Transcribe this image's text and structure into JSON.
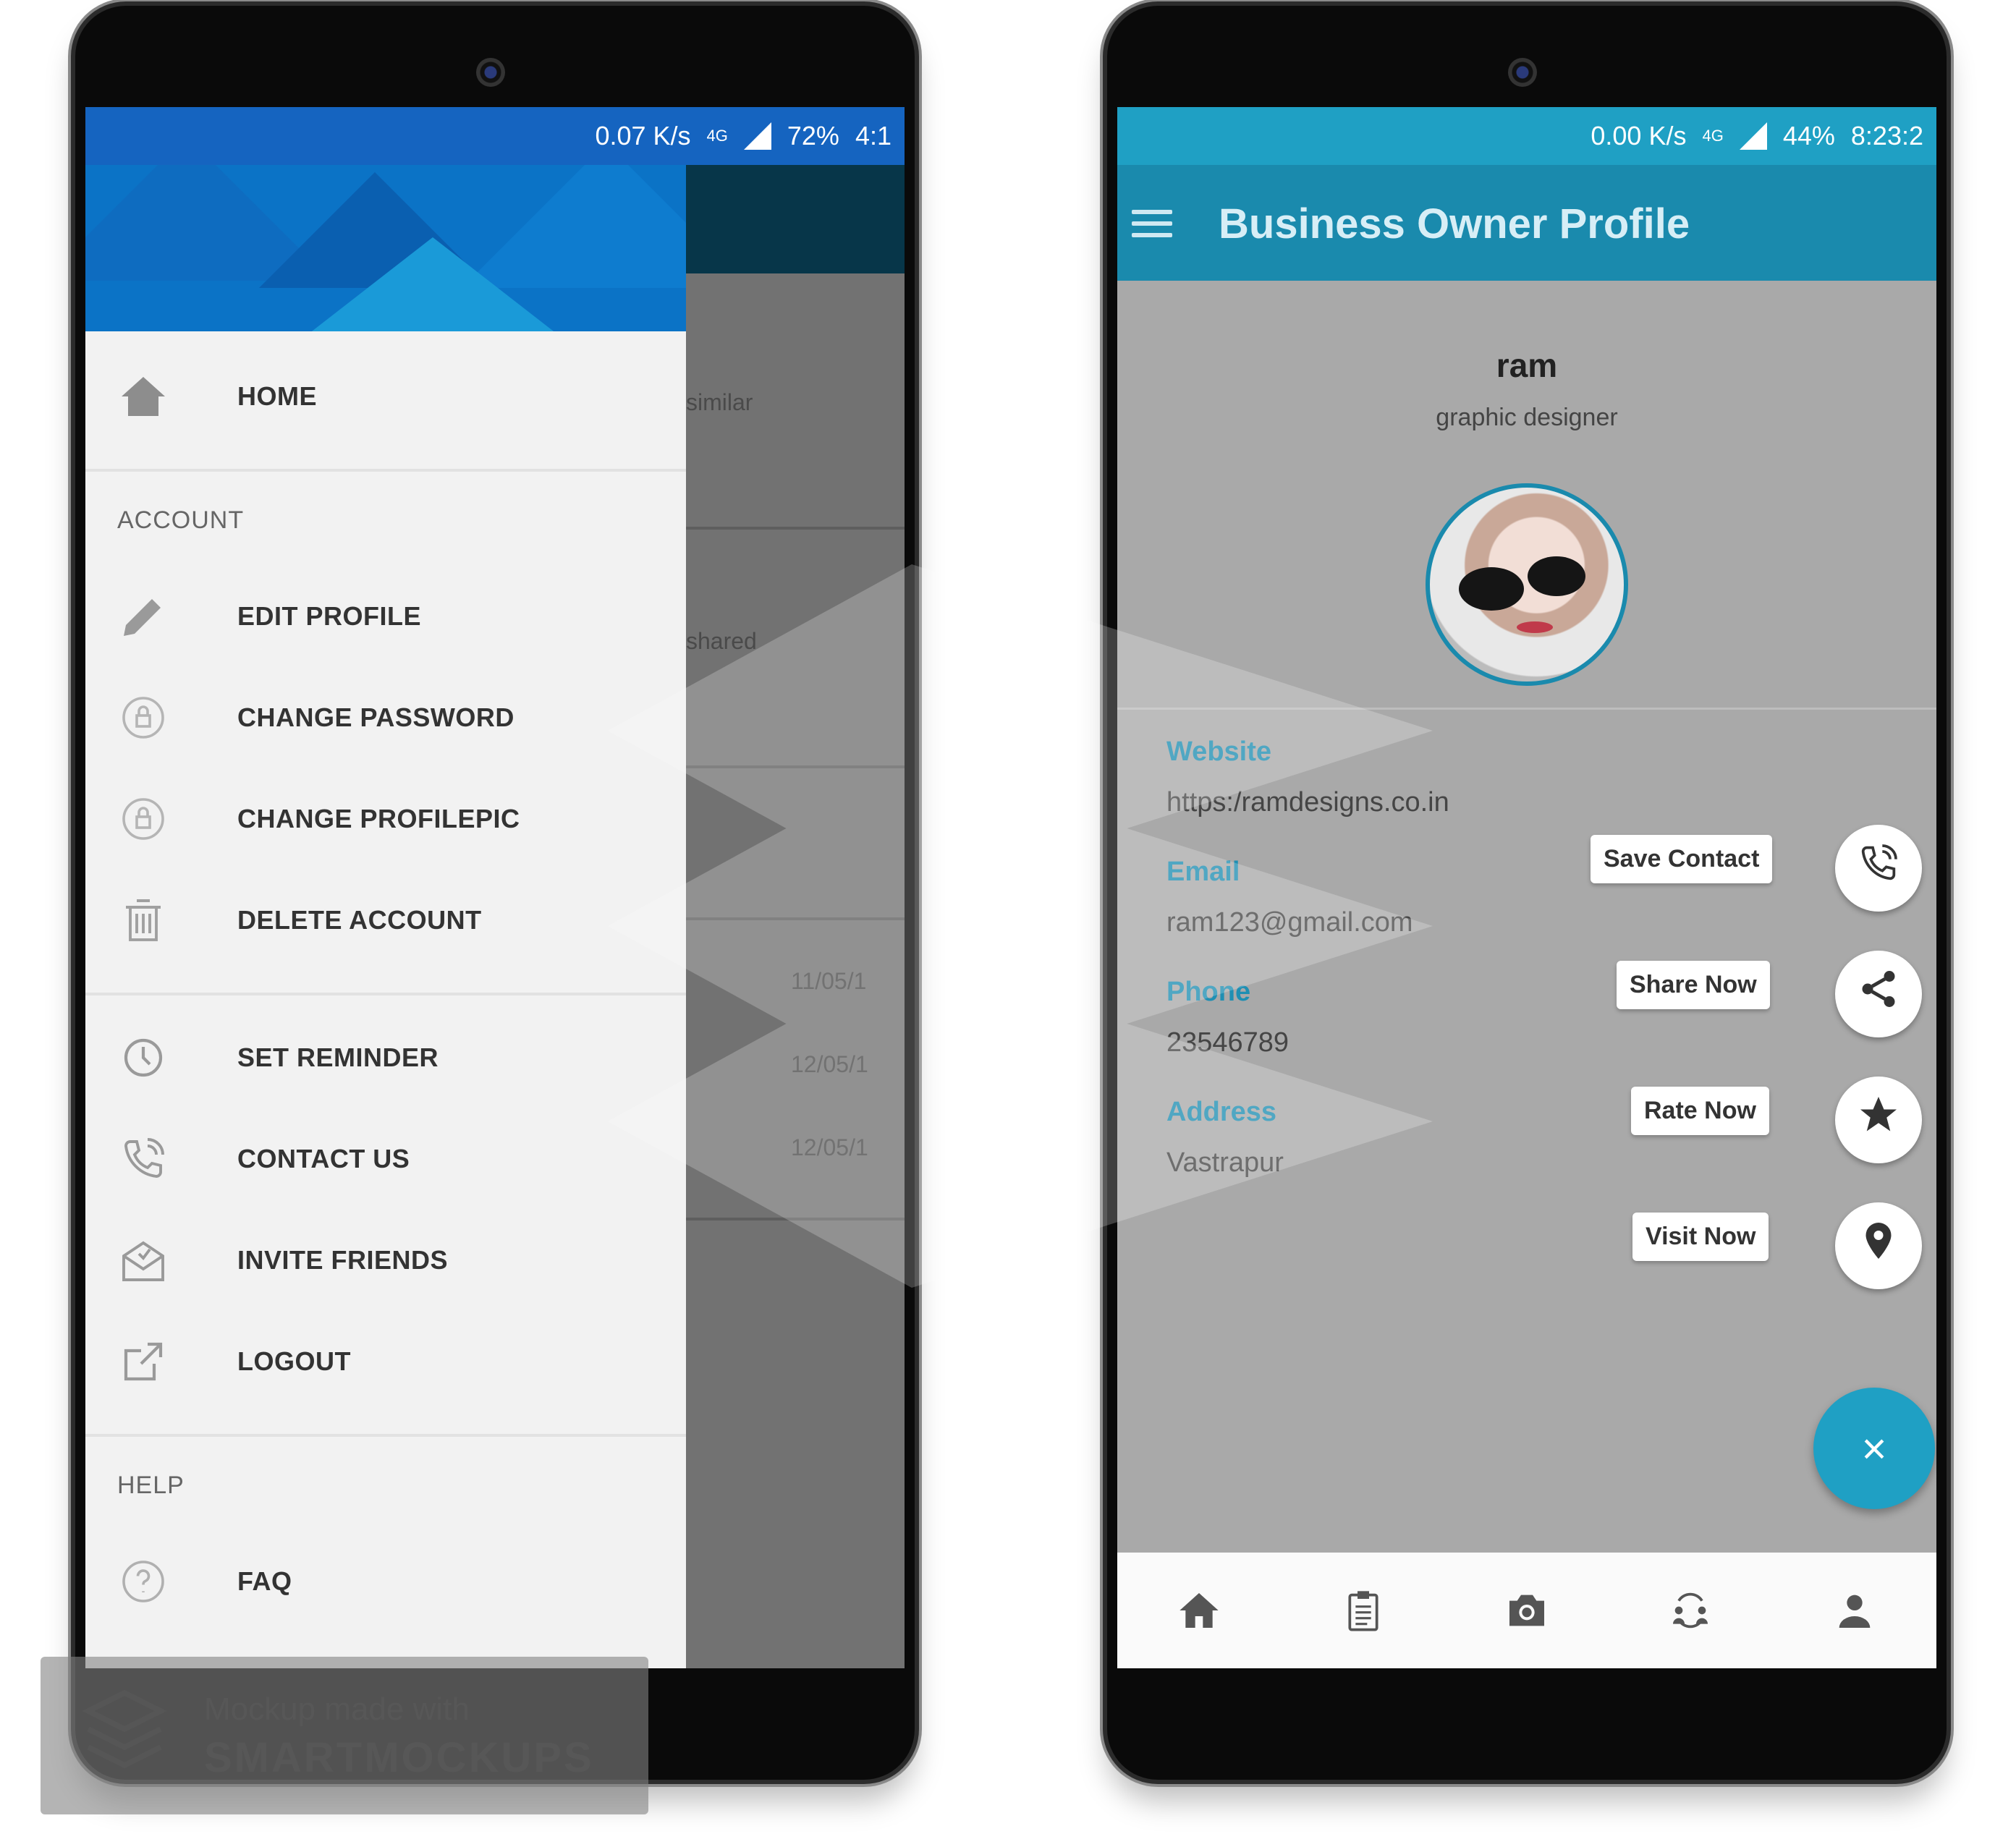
{
  "left_phone": {
    "status": {
      "speed": "0.07 K/s",
      "network": "4G",
      "battery": "72%",
      "time": "4:1"
    },
    "behind": {
      "item1": "similar",
      "item2": "shared",
      "dates": [
        "11/05/1",
        "12/05/1",
        "12/05/1"
      ]
    },
    "drawer": {
      "home": "HOME",
      "account_header": "ACCOUNT",
      "edit_profile": "EDIT PROFILE",
      "change_password": "CHANGE PASSWORD",
      "change_profilepic": "CHANGE PROFILEPIC",
      "delete_account": "DELETE ACCOUNT",
      "set_reminder": "SET REMINDER",
      "contact_us": "CONTACT US",
      "invite_friends": "INVITE FRIENDS",
      "logout": "LOGOUT",
      "help_header": "HELP",
      "faq": "FAQ"
    }
  },
  "right_phone": {
    "status": {
      "speed": "0.00 K/s",
      "network": "4G",
      "battery": "44%",
      "time": "8:23:2"
    },
    "appbar": {
      "title": "Business Owner Profile"
    },
    "profile": {
      "name": "ram",
      "role": "graphic designer",
      "website_label": "Website",
      "website_value": "https:/ramdesigns.co.in",
      "email_label": "Email",
      "email_value": "ram123@gmail.com",
      "phone_label": "Phone",
      "phone_value": "23546789",
      "address_label": "Address",
      "address_value": "Vastrapur"
    },
    "fab_actions": {
      "save_contact": "Save Contact",
      "share_now": "Share Now",
      "rate_now": "Rate Now",
      "visit_now": "Visit Now",
      "close": "×"
    }
  },
  "watermark": {
    "line1": "Mockup made with",
    "line2": "SMARTMOCKUPS"
  },
  "colors": {
    "left_status": "#1564c0",
    "right_accent": "#1fa0c4",
    "label_blue": "#1f8fb3"
  }
}
